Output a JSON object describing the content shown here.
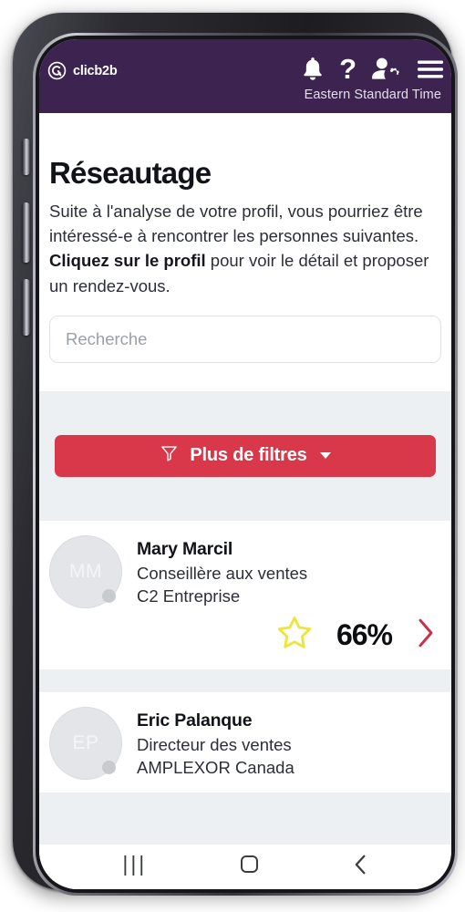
{
  "header": {
    "brand_name": "clicb2b",
    "brand_icon": "clicb2b-logo-icon",
    "timezone_label": "Eastern Standard Time",
    "icons": [
      {
        "name": "notifications-bell-icon",
        "glyph": "bell"
      },
      {
        "name": "help-question-icon",
        "glyph": "?"
      },
      {
        "name": "user-settings-icon",
        "glyph": "user-gear"
      },
      {
        "name": "hamburger-menu-icon",
        "glyph": "hamburger"
      }
    ],
    "background_color": "#3D2450"
  },
  "intro": {
    "title": "Réseautage",
    "paragraph1": "Suite à l'analyse de votre profil, vous pourriez être intéressé-e à rencontrer les personnes suivantes.",
    "bold_lead": "Cliquez sur le profil",
    "paragraph2_rest": " pour voir le détail et proposer un rendez-vous."
  },
  "search": {
    "placeholder": "Recherche",
    "value": ""
  },
  "filters": {
    "button_label": "Plus de filtres",
    "funnel_icon": "funnel-filter-icon",
    "caret_icon": "chevron-down-icon",
    "button_color": "#D9384A"
  },
  "contacts": [
    {
      "initials": "MM",
      "name": "Mary Marcil",
      "role": "Conseillère aux ventes",
      "organization": "C2 Entreprise",
      "match_percent": "66%",
      "favorite_icon": "star-outline-icon",
      "favorite_color": "#EFE438",
      "chevron_icon": "chevron-right-icon",
      "chevron_color": "#C9304A",
      "has_footer": true
    },
    {
      "initials": "EP",
      "name": "Eric Palanque",
      "role": "Directeur des ventes",
      "organization": "AMPLEXOR Canada",
      "match_percent": "",
      "favorite_icon": "star-outline-icon",
      "favorite_color": "#EFE438",
      "chevron_icon": "chevron-right-icon",
      "chevron_color": "#C9304A",
      "has_footer": false
    }
  ],
  "nav_bar": {
    "recents_label": "|||",
    "recents_icon": "recent-apps-icon",
    "home_icon": "home-square-icon",
    "back_icon": "back-chevron-icon"
  }
}
